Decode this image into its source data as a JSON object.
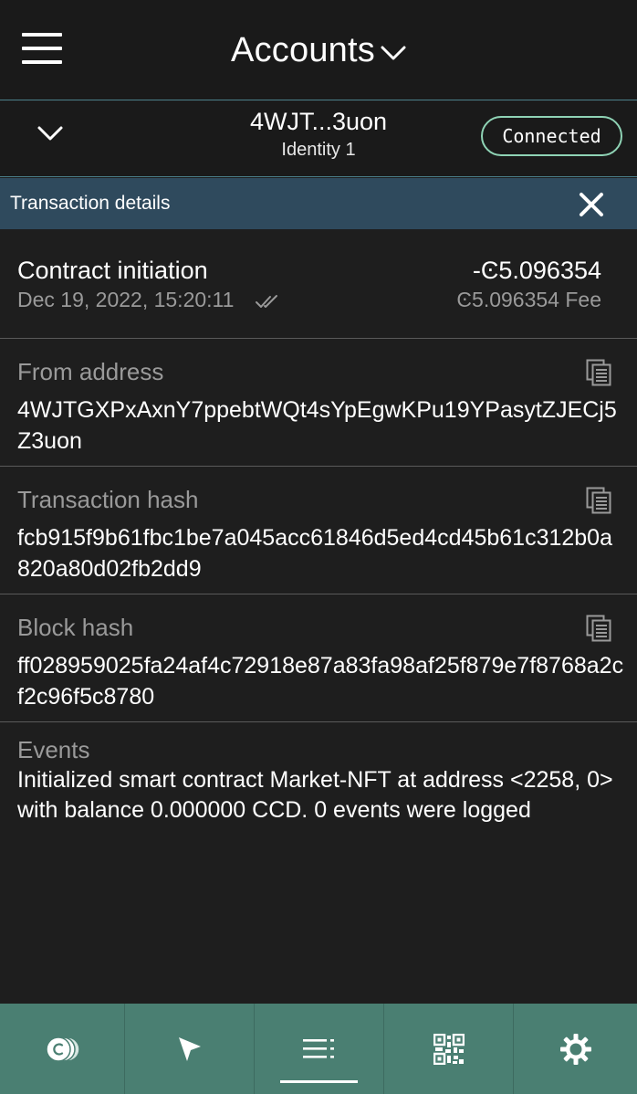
{
  "header": {
    "title": "Accounts"
  },
  "account": {
    "address_short": "4WJT...3uon",
    "identity": "Identity 1",
    "status": "Connected"
  },
  "detail": {
    "title": "Transaction details",
    "type": "Contract initiation",
    "date": "Dec 19, 2022, 15:20:11",
    "amount": "-Ͼ5.096354",
    "fee": "Ͼ5.096354 Fee"
  },
  "from": {
    "label": "From address",
    "value": "4WJTGXPxAxnY7ppebtWQt4sYpEgwKPu19YPasytZJECj5Z3uon"
  },
  "tx_hash": {
    "label": "Transaction hash",
    "value": "fcb915f9b61fbc1be7a045acc61846d5ed4cd45b61c312b0a820a80d02fb2dd9"
  },
  "block_hash": {
    "label": "Block hash",
    "value": "ff028959025fa24af4c72918e87a83fa98af25f879e7f8768a2cf2c96f5c8780"
  },
  "events": {
    "label": "Events",
    "value": "Initialized smart contract Market-NFT at address <2258, 0> with balance 0.000000 CCD. 0 events were logged"
  },
  "nav": {
    "items": [
      "tokens-icon",
      "send-icon",
      "transactions-icon",
      "qr-code-icon",
      "settings-icon"
    ],
    "active": "transactions-icon"
  },
  "colors": {
    "background": "#1e1e1e",
    "header_bar": "#2f4a5d",
    "connected_border": "#8fd3b5",
    "bottom_nav": "#4a7f72",
    "muted_text": "#9a9a9a"
  }
}
